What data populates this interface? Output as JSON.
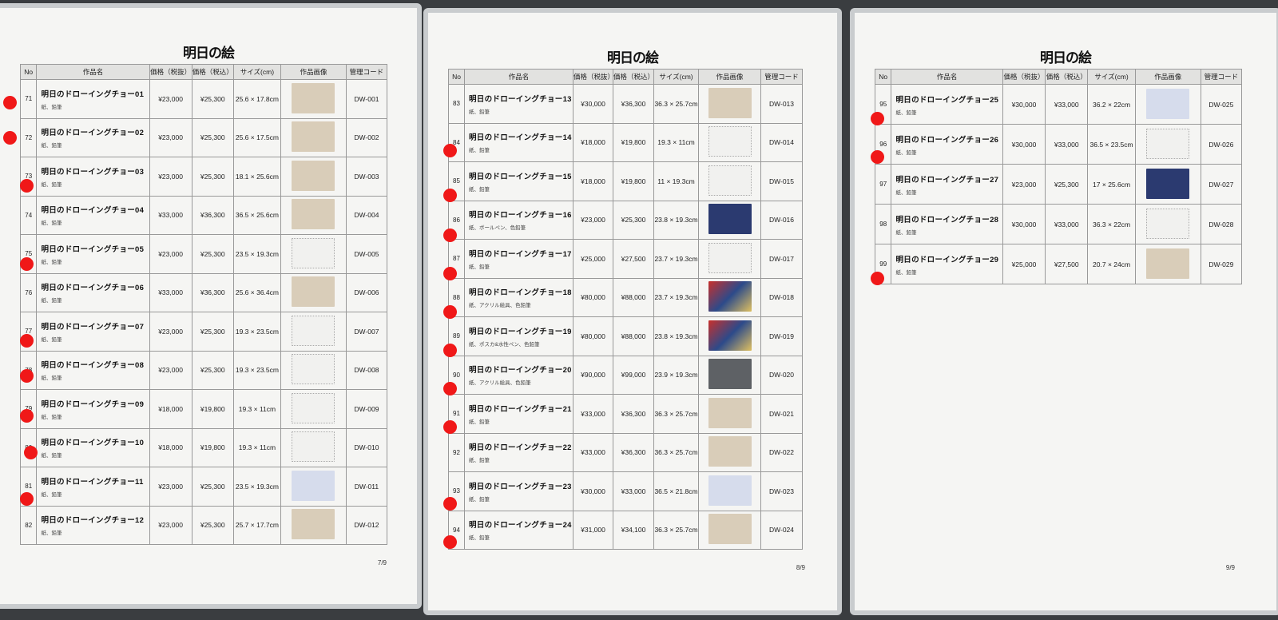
{
  "logo_text": "明日の絵",
  "table_headers": [
    "No",
    "作品名",
    "価格（税抜）",
    "価格（税込）",
    "サイズ(cm)",
    "作品画像",
    "管理コード"
  ],
  "pages": [
    {
      "page_label": "7/9",
      "rows": [
        {
          "no": "71",
          "title": "明日のドローイングチョー01",
          "medium": "紙、鉛筆",
          "price_ex": "¥23,000",
          "price_in": "¥25,300",
          "size": "25.6 × 17.8cm",
          "code": "DW-001",
          "art": "beige"
        },
        {
          "no": "72",
          "title": "明日のドローイングチョー02",
          "medium": "紙、鉛筆",
          "price_ex": "¥23,000",
          "price_in": "¥25,300",
          "size": "25.6 × 17.5cm",
          "code": "DW-002",
          "art": "beige"
        },
        {
          "no": "73",
          "title": "明日のドローイングチョー03",
          "medium": "紙、鉛筆",
          "price_ex": "¥23,000",
          "price_in": "¥25,300",
          "size": "18.1 × 25.6cm",
          "code": "DW-003",
          "art": "beige"
        },
        {
          "no": "74",
          "title": "明日のドローイングチョー04",
          "medium": "紙、鉛筆",
          "price_ex": "¥33,000",
          "price_in": "¥36,300",
          "size": "36.5 × 25.6cm",
          "code": "DW-004",
          "art": "beige"
        },
        {
          "no": "75",
          "title": "明日のドローイングチョー05",
          "medium": "紙、鉛筆",
          "price_ex": "¥23,000",
          "price_in": "¥25,300",
          "size": "23.5 × 19.3cm",
          "code": "DW-005",
          "art": "white"
        },
        {
          "no": "76",
          "title": "明日のドローイングチョー06",
          "medium": "紙、鉛筆",
          "price_ex": "¥33,000",
          "price_in": "¥36,300",
          "size": "25.6 × 36.4cm",
          "code": "DW-006",
          "art": "beige"
        },
        {
          "no": "77",
          "title": "明日のドローイングチョー07",
          "medium": "紙、鉛筆",
          "price_ex": "¥23,000",
          "price_in": "¥25,300",
          "size": "19.3 × 23.5cm",
          "code": "DW-007",
          "art": "white"
        },
        {
          "no": "78",
          "title": "明日のドローイングチョー08",
          "medium": "紙、鉛筆",
          "price_ex": "¥23,000",
          "price_in": "¥25,300",
          "size": "19.3 × 23.5cm",
          "code": "DW-008",
          "art": "white"
        },
        {
          "no": "79",
          "title": "明日のドローイングチョー09",
          "medium": "紙、鉛筆",
          "price_ex": "¥18,000",
          "price_in": "¥19,800",
          "size": "19.3 × 11cm",
          "code": "DW-009",
          "art": "white"
        },
        {
          "no": "80",
          "title": "明日のドローイングチョー10",
          "medium": "紙、鉛筆",
          "price_ex": "¥18,000",
          "price_in": "¥19,800",
          "size": "19.3 × 11cm",
          "code": "DW-010",
          "art": "white"
        },
        {
          "no": "81",
          "title": "明日のドローイングチョー11",
          "medium": "紙、鉛筆",
          "price_ex": "¥23,000",
          "price_in": "¥25,300",
          "size": "23.5 × 19.3cm",
          "code": "DW-011",
          "art": "blue"
        },
        {
          "no": "82",
          "title": "明日のドローイングチョー12",
          "medium": "紙、鉛筆",
          "price_ex": "¥23,000",
          "price_in": "¥25,300",
          "size": "25.7 × 17.7cm",
          "code": "DW-012",
          "art": "beige"
        }
      ]
    },
    {
      "page_label": "8/9",
      "rows": [
        {
          "no": "83",
          "title": "明日のドローイングチョー13",
          "medium": "紙、鉛筆",
          "price_ex": "¥30,000",
          "price_in": "¥36,300",
          "size": "36.3 × 25.7cm",
          "code": "DW-013",
          "art": "beige"
        },
        {
          "no": "84",
          "title": "明日のドローイングチョー14",
          "medium": "紙、鉛筆",
          "price_ex": "¥18,000",
          "price_in": "¥19,800",
          "size": "19.3 × 11cm",
          "code": "DW-014",
          "art": "white"
        },
        {
          "no": "85",
          "title": "明日のドローイングチョー15",
          "medium": "紙、鉛筆",
          "price_ex": "¥18,000",
          "price_in": "¥19,800",
          "size": "11 × 19.3cm",
          "code": "DW-015",
          "art": "white"
        },
        {
          "no": "86",
          "title": "明日のドローイングチョー16",
          "medium": "紙、ボールペン、色鉛筆",
          "price_ex": "¥23,000",
          "price_in": "¥25,300",
          "size": "23.8 × 19.3cm",
          "code": "DW-016",
          "art": "navy"
        },
        {
          "no": "87",
          "title": "明日のドローイングチョー17",
          "medium": "紙、鉛筆",
          "price_ex": "¥25,000",
          "price_in": "¥27,500",
          "size": "23.7 × 19.3cm",
          "code": "DW-017",
          "art": "white"
        },
        {
          "no": "88",
          "title": "明日のドローイングチョー18",
          "medium": "紙、アクリル絵具、色鉛筆",
          "price_ex": "¥80,000",
          "price_in": "¥88,000",
          "size": "23.7 × 19.3cm",
          "code": "DW-018",
          "art": "color"
        },
        {
          "no": "89",
          "title": "明日のドローイングチョー19",
          "medium": "紙、ポスカ&水性ペン、色鉛筆",
          "price_ex": "¥80,000",
          "price_in": "¥88,000",
          "size": "23.8 × 19.3cm",
          "code": "DW-019",
          "art": "color"
        },
        {
          "no": "90",
          "title": "明日のドローイングチョー20",
          "medium": "紙、アクリル絵具、色鉛筆",
          "price_ex": "¥90,000",
          "price_in": "¥99,000",
          "size": "23.9 × 19.3cm",
          "code": "DW-020",
          "art": "dark"
        },
        {
          "no": "91",
          "title": "明日のドローイングチョー21",
          "medium": "紙、鉛筆",
          "price_ex": "¥33,000",
          "price_in": "¥36,300",
          "size": "36.3 × 25.7cm",
          "code": "DW-021",
          "art": "beige"
        },
        {
          "no": "92",
          "title": "明日のドローイングチョー22",
          "medium": "紙、鉛筆",
          "price_ex": "¥33,000",
          "price_in": "¥36,300",
          "size": "36.3 × 25.7cm",
          "code": "DW-022",
          "art": "beige"
        },
        {
          "no": "93",
          "title": "明日のドローイングチョー23",
          "medium": "紙、鉛筆",
          "price_ex": "¥30,000",
          "price_in": "¥33,000",
          "size": "36.5 × 21.8cm",
          "code": "DW-023",
          "art": "blue"
        },
        {
          "no": "94",
          "title": "明日のドローイングチョー24",
          "medium": "紙、鉛筆",
          "price_ex": "¥31,000",
          "price_in": "¥34,100",
          "size": "36.3 × 25.7cm",
          "code": "DW-024",
          "art": "beige"
        }
      ]
    },
    {
      "page_label": "9/9",
      "rows": [
        {
          "no": "95",
          "title": "明日のドローイングチョー25",
          "medium": "紙、鉛筆",
          "price_ex": "¥30,000",
          "price_in": "¥33,000",
          "size": "36.2 × 22cm",
          "code": "DW-025",
          "art": "blue"
        },
        {
          "no": "96",
          "title": "明日のドローイングチョー26",
          "medium": "紙、鉛筆",
          "price_ex": "¥30,000",
          "price_in": "¥33,000",
          "size": "36.5 × 23.5cm",
          "code": "DW-026",
          "art": "white"
        },
        {
          "no": "97",
          "title": "明日のドローイングチョー27",
          "medium": "紙、鉛筆",
          "price_ex": "¥23,000",
          "price_in": "¥25,300",
          "size": "17 × 25.6cm",
          "code": "DW-027",
          "art": "navy"
        },
        {
          "no": "98",
          "title": "明日のドローイングチョー28",
          "medium": "紙、鉛筆",
          "price_ex": "¥30,000",
          "price_in": "¥33,000",
          "size": "36.3 × 22cm",
          "code": "DW-028",
          "art": "white"
        },
        {
          "no": "99",
          "title": "明日のドローイングチョー29",
          "medium": "紙、鉛筆",
          "price_ex": "¥25,000",
          "price_in": "¥27,500",
          "size": "20.7 × 24cm",
          "code": "DW-029",
          "art": "beige"
        }
      ]
    }
  ]
}
